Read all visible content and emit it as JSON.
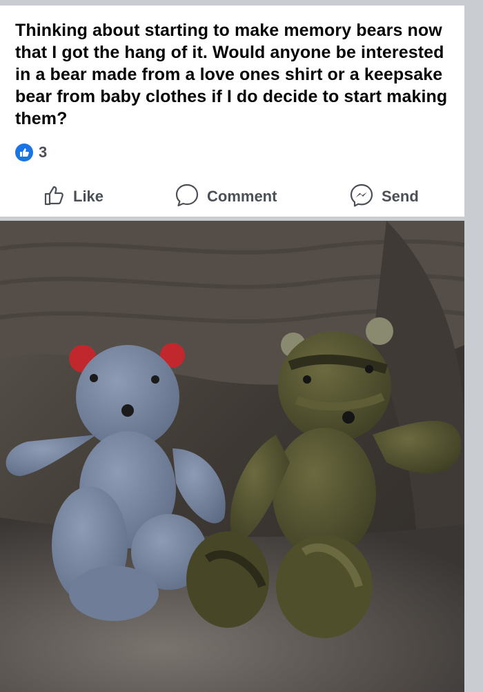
{
  "post": {
    "text": "Thinking about starting to make memory bears now that I got the hang of it. Would anyone be interested in a bear made from a love ones shirt or a keepsake bear from baby clothes if I do decide to start making them?",
    "reaction_count": "3",
    "reaction_icon": "thumbs-up-icon",
    "accent_color": "#1b74e4"
  },
  "actions": {
    "like_label": "Like",
    "comment_label": "Comment",
    "send_label": "Send"
  },
  "photo": {
    "subject": "two-handmade-teddy-bears-photo"
  }
}
